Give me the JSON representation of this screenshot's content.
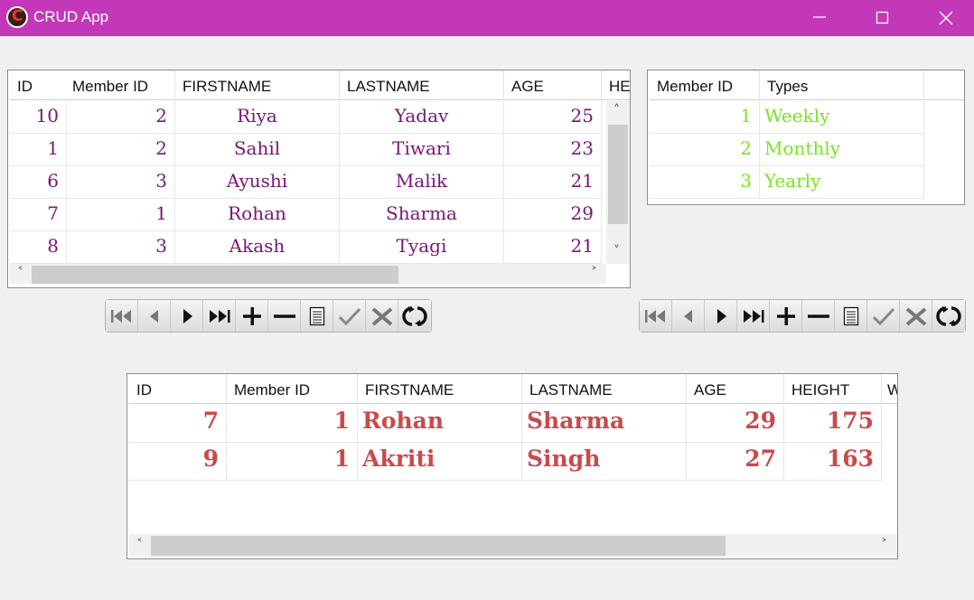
{
  "window": {
    "title": "CRUD App",
    "icon_letter": "C",
    "titlebar_color": "#c238b8",
    "buttons": [
      "minimize",
      "maximize",
      "close"
    ]
  },
  "members_grid": {
    "columns": [
      "ID",
      "Member ID",
      "FIRSTNAME",
      "LASTNAME",
      "AGE",
      "HEI"
    ],
    "rows": [
      {
        "id": "10",
        "member_id": "2",
        "firstname": "Riya",
        "lastname": "Yadav",
        "age": "25"
      },
      {
        "id": "1",
        "member_id": "2",
        "firstname": "Sahil",
        "lastname": "Tiwari",
        "age": "23"
      },
      {
        "id": "6",
        "member_id": "3",
        "firstname": "Ayushi",
        "lastname": "Malik",
        "age": "21"
      },
      {
        "id": "7",
        "member_id": "1",
        "firstname": "Rohan",
        "lastname": "Sharma",
        "age": "29"
      },
      {
        "id": "8",
        "member_id": "3",
        "firstname": "Akash",
        "lastname": "Tyagi",
        "age": "21"
      }
    ],
    "text_color": "#7a147a"
  },
  "types_grid": {
    "columns": [
      "Member ID",
      "Types"
    ],
    "rows": [
      {
        "member_id": "1",
        "type": "Weekly"
      },
      {
        "member_id": "2",
        "type": "Monthly"
      },
      {
        "member_id": "3",
        "type": "Yearly"
      }
    ],
    "text_color": "#79e61d"
  },
  "detail_grid": {
    "columns": [
      "ID",
      "Member ID",
      "FIRSTNAME",
      "LASTNAME",
      "AGE",
      "HEIGHT",
      "W"
    ],
    "rows": [
      {
        "id": "7",
        "member_id": "1",
        "firstname": "Rohan",
        "lastname": "Sharma",
        "age": "29",
        "height": "175"
      },
      {
        "id": "9",
        "member_id": "1",
        "firstname": "Akriti",
        "lastname": "Singh",
        "age": "27",
        "height": "163"
      }
    ],
    "text_color": "#c94a4a"
  },
  "navigator": {
    "buttons": [
      "first-icon",
      "prior-icon",
      "next-icon",
      "last-icon",
      "insert-icon",
      "delete-icon",
      "edit-icon",
      "post-icon",
      "cancel-icon",
      "refresh-icon"
    ]
  }
}
